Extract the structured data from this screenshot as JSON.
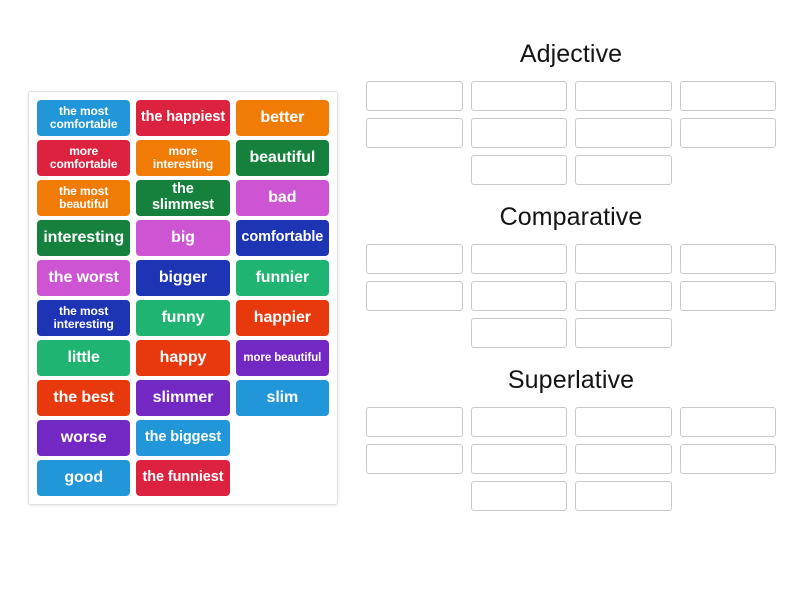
{
  "activity": {
    "type": "group-sort",
    "tray_columns": 3
  },
  "tiles": [
    {
      "label": "the most\ncomfortable",
      "color": "#2196d9",
      "lines": 2,
      "size": "sm"
    },
    {
      "label": "the happiest",
      "color": "#dd2240",
      "lines": 1,
      "size": "md"
    },
    {
      "label": "better",
      "color": "#f07c06",
      "lines": 1,
      "size": "lg"
    },
    {
      "label": "more\ncomfortable",
      "color": "#dd2240",
      "lines": 2,
      "size": "sm"
    },
    {
      "label": "more\ninteresting",
      "color": "#f07c06",
      "lines": 2,
      "size": "sm"
    },
    {
      "label": "beautiful",
      "color": "#16813d",
      "lines": 1,
      "size": "lg"
    },
    {
      "label": "the most\nbeautiful",
      "color": "#f07c06",
      "lines": 2,
      "size": "sm"
    },
    {
      "label": "the slimmest",
      "color": "#16813d",
      "lines": 1,
      "size": "md"
    },
    {
      "label": "bad",
      "color": "#cd55d4",
      "lines": 1,
      "size": "lg"
    },
    {
      "label": "interesting",
      "color": "#16813d",
      "lines": 1,
      "size": "lg"
    },
    {
      "label": "big",
      "color": "#cd55d4",
      "lines": 1,
      "size": "lg"
    },
    {
      "label": "comfortable",
      "color": "#1d34b5",
      "lines": 1,
      "size": "md"
    },
    {
      "label": "the worst",
      "color": "#cd55d4",
      "lines": 1,
      "size": "lg"
    },
    {
      "label": "bigger",
      "color": "#1d34b5",
      "lines": 1,
      "size": "lg"
    },
    {
      "label": "funnier",
      "color": "#20b473",
      "lines": 1,
      "size": "lg"
    },
    {
      "label": "the most\ninteresting",
      "color": "#1d34b5",
      "lines": 2,
      "size": "sm"
    },
    {
      "label": "funny",
      "color": "#20b473",
      "lines": 1,
      "size": "lg"
    },
    {
      "label": "happier",
      "color": "#e8380d",
      "lines": 1,
      "size": "lg"
    },
    {
      "label": "little",
      "color": "#20b473",
      "lines": 1,
      "size": "lg"
    },
    {
      "label": "happy",
      "color": "#e8380d",
      "lines": 1,
      "size": "lg"
    },
    {
      "label": "more beautiful",
      "color": "#7328c4",
      "lines": 1,
      "size": "xs"
    },
    {
      "label": "the best",
      "color": "#e8380d",
      "lines": 1,
      "size": "lg"
    },
    {
      "label": "slimmer",
      "color": "#7328c4",
      "lines": 1,
      "size": "lg"
    },
    {
      "label": "slim",
      "color": "#2196d9",
      "lines": 1,
      "size": "lg"
    },
    {
      "label": "worse",
      "color": "#7328c4",
      "lines": 1,
      "size": "lg"
    },
    {
      "label": "the biggest",
      "color": "#2196d9",
      "lines": 1,
      "size": "md"
    },
    {
      "label": "",
      "color": "",
      "lines": 0,
      "size": "lg"
    },
    {
      "label": "good",
      "color": "#2196d9",
      "lines": 1,
      "size": "lg"
    },
    {
      "label": "the funniest",
      "color": "#dd2240",
      "lines": 1,
      "size": "md"
    },
    {
      "label": "",
      "color": "",
      "lines": 0,
      "size": "lg"
    }
  ],
  "groups": [
    {
      "title": "Adjective",
      "slots": 10
    },
    {
      "title": "Comparative",
      "slots": 10
    },
    {
      "title": "Superlative",
      "slots": 10
    }
  ]
}
